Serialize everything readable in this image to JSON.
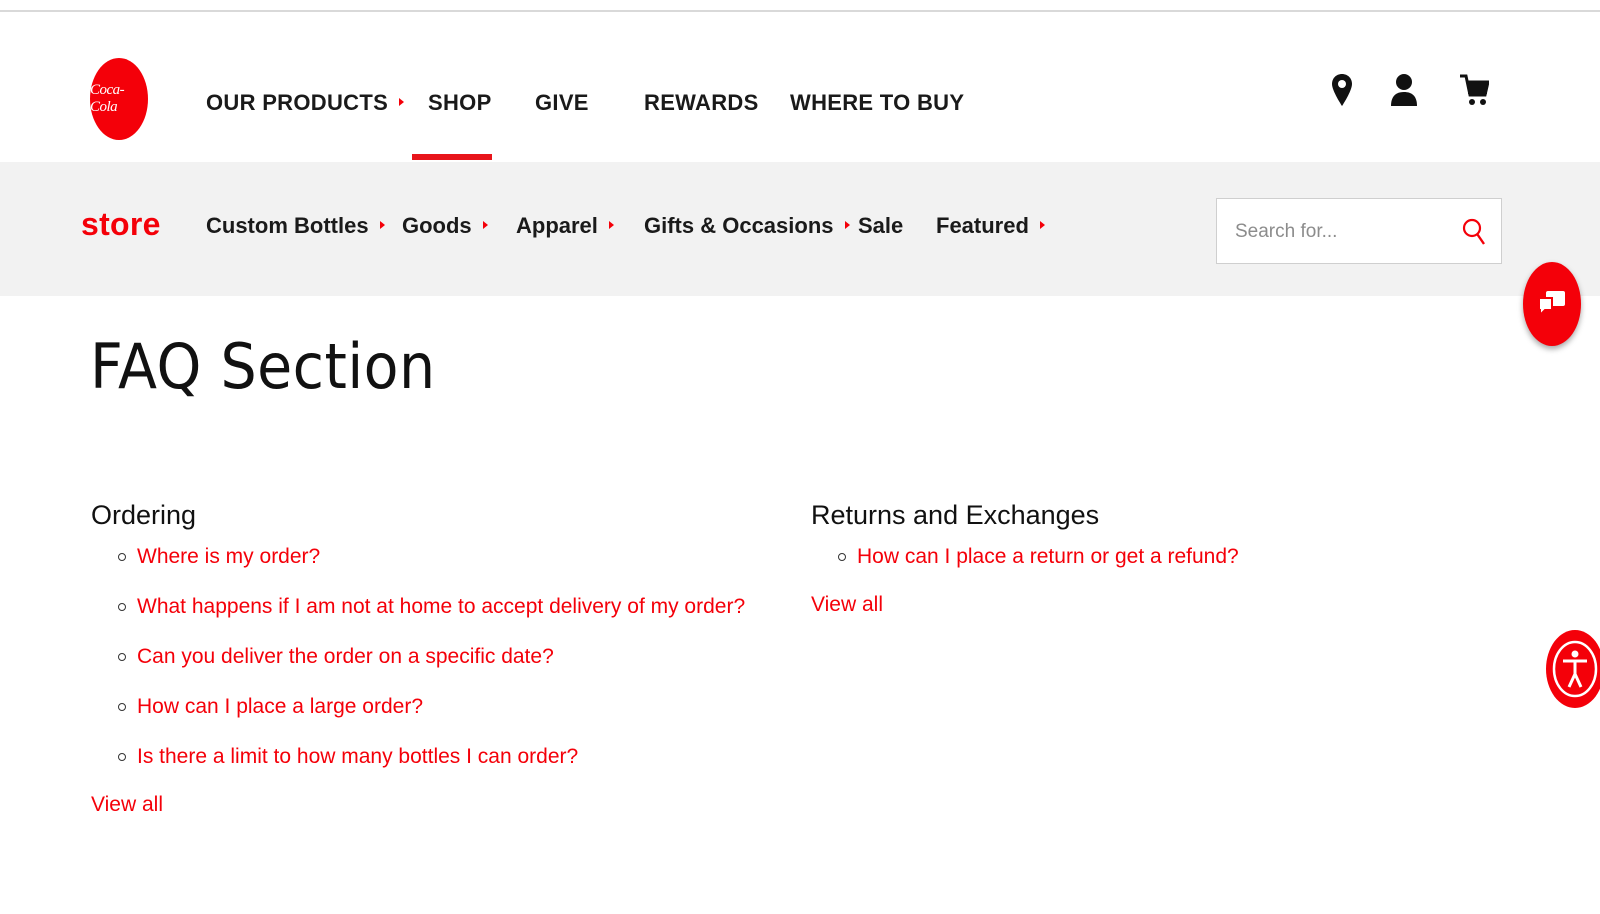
{
  "brand": {
    "logo_text": "Coca-Cola",
    "accent": "#f40009"
  },
  "main_nav": [
    {
      "label": "OUR PRODUCTS",
      "has_caret": true
    },
    {
      "label": "SHOP",
      "active": true
    },
    {
      "label": "GIVE"
    },
    {
      "label": "REWARDS"
    },
    {
      "label": "WHERE TO BUY"
    }
  ],
  "header_icons": [
    "location-pin-icon",
    "user-icon",
    "cart-icon"
  ],
  "store_bar": {
    "label": "store",
    "items": [
      {
        "label": "Custom Bottles",
        "has_caret": true
      },
      {
        "label": "Goods",
        "has_caret": true
      },
      {
        "label": "Apparel",
        "has_caret": true
      },
      {
        "label": "Gifts & Occasions",
        "has_caret": true
      },
      {
        "label": "Sale"
      },
      {
        "label": "Featured",
        "has_caret": true
      }
    ],
    "search_placeholder": "Search for..."
  },
  "page": {
    "title": "FAQ Section",
    "sections": [
      {
        "heading": "Ordering",
        "questions": [
          "Where is my order?",
          "What happens if I am not at home to accept delivery of my order?",
          "Can you deliver the order on a specific date?",
          "How can I place a large order?",
          "Is there a limit to how many bottles I can order?"
        ],
        "view_all": "View all"
      },
      {
        "heading": "Returns and Exchanges",
        "questions": [
          "How can I place a return or get a refund?"
        ],
        "view_all": "View all"
      }
    ]
  },
  "floating": [
    "chat-icon",
    "accessibility-icon"
  ]
}
